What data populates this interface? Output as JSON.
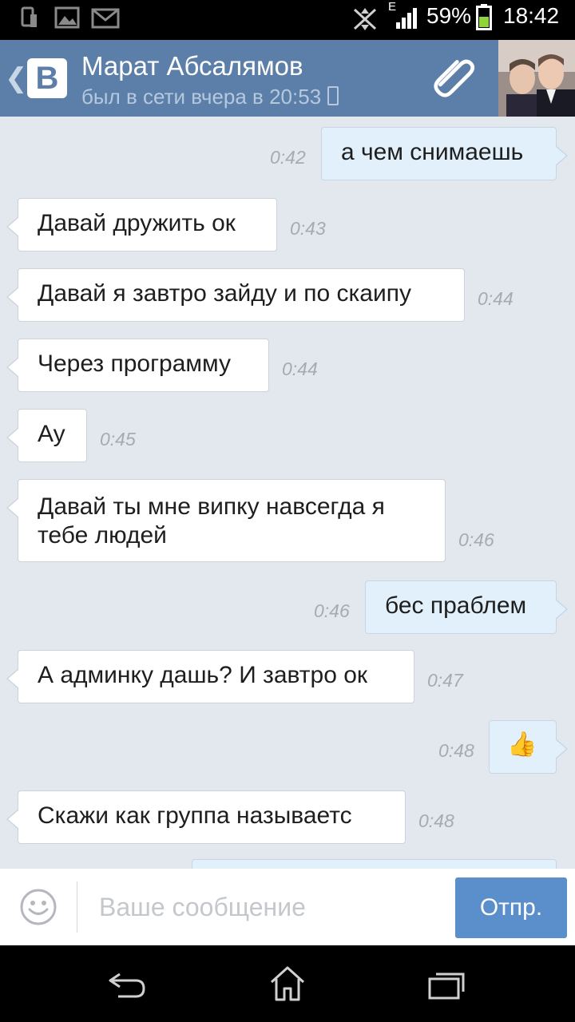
{
  "status_bar": {
    "battery": "59%",
    "network_type": "E",
    "time": "18:42"
  },
  "header": {
    "back_icon": "chevron-left-icon",
    "logo_letter": "В",
    "contact_name": "Марат Абсалямов",
    "contact_status": "был в сети вчера в 20:53",
    "attach_icon": "paperclip-icon"
  },
  "messages": [
    {
      "direction": "out",
      "text": "а чем снимаешь",
      "time": "0:42"
    },
    {
      "direction": "in",
      "text": "Давай дружить ок",
      "time": "0:43"
    },
    {
      "direction": "in",
      "text": "Давай я завтро зайду и по скаипу",
      "time": "0:44"
    },
    {
      "direction": "in",
      "text": "Через программу",
      "time": "0:44"
    },
    {
      "direction": "in",
      "text": "Ау",
      "time": "0:45"
    },
    {
      "direction": "in",
      "text": "Давай ты мне випку навсегда я\nтебе людей",
      "time": "0:46"
    },
    {
      "direction": "out",
      "text": "бес праблем",
      "time": "0:46"
    },
    {
      "direction": "in",
      "text": "А админку дашь? И завтро ок",
      "time": "0:47"
    },
    {
      "direction": "out",
      "text": "",
      "emoji": "👍",
      "time": "0:48"
    },
    {
      "direction": "in",
      "text": "Скажи как группа называетс",
      "time": "0:48"
    }
  ],
  "composer": {
    "placeholder": "Ваше сообщение",
    "send_label": "Отпр.",
    "emoji_icon": "smiley-icon"
  },
  "colors": {
    "header_bg": "#5b7fa8",
    "chat_bg": "#e3e8ee",
    "outgoing_bubble": "#e1f0fb",
    "send_button": "#5b8fcc"
  }
}
